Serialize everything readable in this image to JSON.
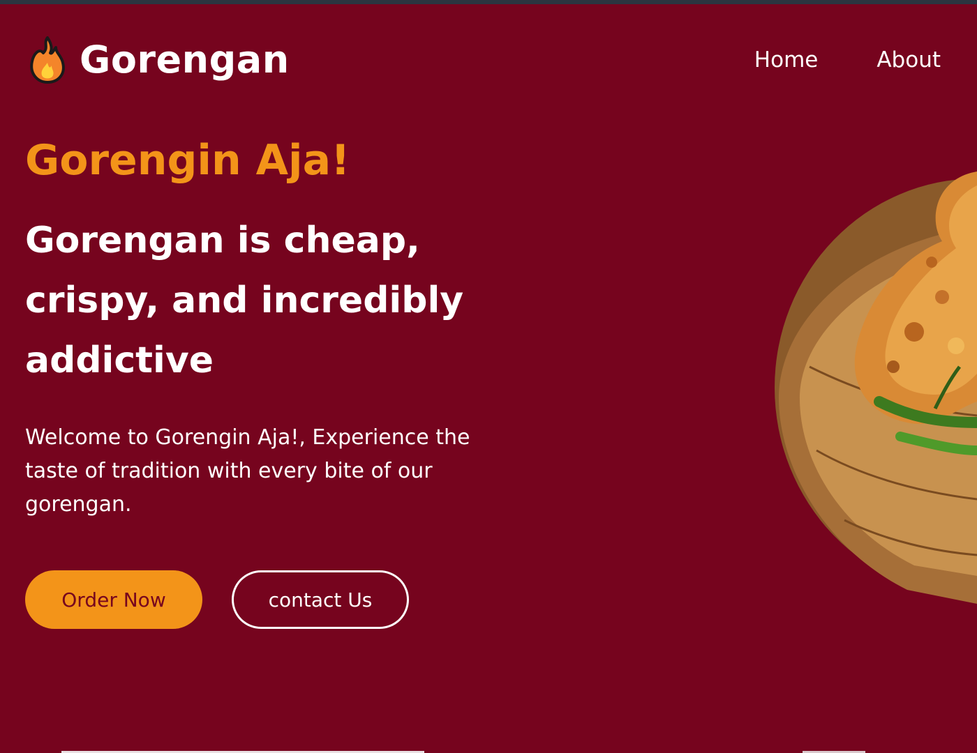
{
  "brand": {
    "name": "Gorengan",
    "icon": "fire-icon"
  },
  "nav": {
    "items": [
      {
        "label": "Home"
      },
      {
        "label": "About"
      }
    ]
  },
  "hero": {
    "title": "Gorengin Aja!",
    "headline": "Gorengan is cheap, crispy, and incredibly addictive",
    "description": "Welcome to Gorengin Aja!, Experience the taste of tradition with every bite of our gorengan.",
    "image": "fried-fritters-in-bamboo-basket",
    "buttons": {
      "order_label": "Order Now",
      "contact_label": "contact Us"
    }
  },
  "colors": {
    "background": "#76041e",
    "accent": "#f39419",
    "text": "#ffffff"
  }
}
